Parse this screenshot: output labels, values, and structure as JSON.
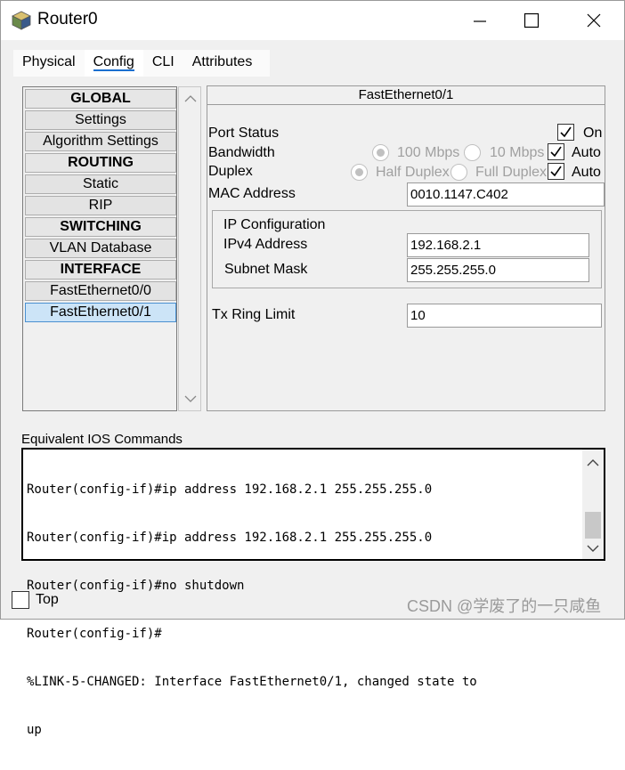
{
  "window": {
    "title": "Router0"
  },
  "tabs": [
    {
      "label": "Physical",
      "active": false
    },
    {
      "label": "Config",
      "active": true
    },
    {
      "label": "CLI",
      "active": false
    },
    {
      "label": "Attributes",
      "active": false
    }
  ],
  "nav": {
    "items": [
      {
        "label": "GLOBAL",
        "header": true
      },
      {
        "label": "Settings",
        "header": false
      },
      {
        "label": "Algorithm Settings",
        "header": false
      },
      {
        "label": "ROUTING",
        "header": true
      },
      {
        "label": "Static",
        "header": false
      },
      {
        "label": "RIP",
        "header": false
      },
      {
        "label": "SWITCHING",
        "header": true
      },
      {
        "label": "VLAN Database",
        "header": false
      },
      {
        "label": "INTERFACE",
        "header": true
      },
      {
        "label": "FastEthernet0/0",
        "header": false
      },
      {
        "label": "FastEthernet0/1",
        "header": false,
        "selected": true
      }
    ]
  },
  "interface": {
    "title": "FastEthernet0/1",
    "port_status_label": "Port Status",
    "port_status_on_label": "On",
    "port_status_on": true,
    "bandwidth_label": "Bandwidth",
    "bandwidth_100": "100 Mbps",
    "bandwidth_10": "10 Mbps",
    "bandwidth_auto_label": "Auto",
    "bandwidth_auto": true,
    "duplex_label": "Duplex",
    "duplex_half": "Half Duplex",
    "duplex_full": "Full Duplex",
    "duplex_auto_label": "Auto",
    "duplex_auto": true,
    "mac_label": "MAC Address",
    "mac_value": "0010.1147.C402",
    "ip_config_label": "IP Configuration",
    "ipv4_label": "IPv4 Address",
    "ipv4_value": "192.168.2.1",
    "mask_label": "Subnet Mask",
    "mask_value": "255.255.255.0",
    "tx_ring_label": "Tx Ring Limit",
    "tx_ring_value": "10"
  },
  "ios": {
    "label": "Equivalent IOS Commands",
    "lines": [
      "Router(config-if)#ip address 192.168.2.1 255.255.255.0",
      "Router(config-if)#ip address 192.168.2.1 255.255.255.0",
      "Router(config-if)#no shutdown",
      "Router(config-if)#",
      "%LINK-5-CHANGED: Interface FastEthernet0/1, changed state to",
      "up"
    ]
  },
  "bottom": {
    "top_label": "Top",
    "top_checked": false,
    "watermark": "CSDN @学废了的一只咸鱼"
  },
  "colors": {
    "accent": "#1a6fd0",
    "selected_bg": "#cce4f7",
    "disabled_text": "#a0a0a0"
  }
}
